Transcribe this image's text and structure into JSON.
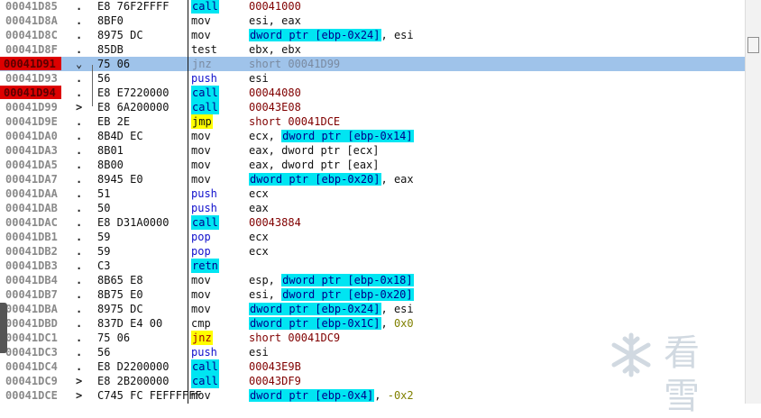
{
  "listing": {
    "rows": [
      {
        "addr": "00041D85",
        "marker": ".",
        "hex": "E8 76F2FFFF",
        "mnemonic": "call",
        "mclass": "call",
        "operand": [
          {
            "t": "00041000",
            "c": "target"
          }
        ]
      },
      {
        "addr": "00041D8A",
        "marker": ".",
        "hex": "8BF0",
        "mnemonic": "mov",
        "mclass": "mov",
        "operand": [
          {
            "t": "esi, eax",
            "c": "plain"
          }
        ]
      },
      {
        "addr": "00041D8C",
        "marker": ".",
        "hex": "8975 DC",
        "mnemonic": "mov",
        "mclass": "mov",
        "operand": [
          {
            "t": "dword ptr [ebp-0x24]",
            "c": "mem"
          },
          {
            "t": ", esi",
            "c": "plain"
          }
        ]
      },
      {
        "addr": "00041D8F",
        "marker": ".",
        "hex": "85DB",
        "mnemonic": "test",
        "mclass": "test",
        "operand": [
          {
            "t": "ebx, ebx",
            "c": "plain"
          }
        ]
      },
      {
        "addr": "00041D91",
        "marker": "⌄",
        "hex": "75 06",
        "mnemonic": "jnz",
        "mclass": "jcc",
        "operand": [
          {
            "t": "short 00041D99",
            "c": "plain"
          }
        ],
        "breakpoint": true,
        "selected": true
      },
      {
        "addr": "00041D93",
        "marker": ".",
        "hex": "56",
        "mnemonic": "push",
        "mclass": "push",
        "operand": [
          {
            "t": "esi",
            "c": "plain"
          }
        ]
      },
      {
        "addr": "00041D94",
        "marker": ".",
        "hex": "E8 E7220000",
        "mnemonic": "call",
        "mclass": "call",
        "operand": [
          {
            "t": "00044080",
            "c": "target"
          }
        ],
        "breakpoint": true
      },
      {
        "addr": "00041D99",
        "marker": ">",
        "hex": "E8 6A200000",
        "mnemonic": "call",
        "mclass": "call",
        "operand": [
          {
            "t": "00043E08",
            "c": "target"
          }
        ]
      },
      {
        "addr": "00041D9E",
        "marker": ".",
        "hex": "EB 2E",
        "mnemonic": "jmp",
        "mclass": "jmp",
        "operand": [
          {
            "t": "short 00041DCE",
            "c": "target"
          }
        ]
      },
      {
        "addr": "00041DA0",
        "marker": ".",
        "hex": "8B4D EC",
        "mnemonic": "mov",
        "mclass": "mov",
        "operand": [
          {
            "t": "ecx, ",
            "c": "plain"
          },
          {
            "t": "dword ptr [ebp-0x14]",
            "c": "mem"
          }
        ]
      },
      {
        "addr": "00041DA3",
        "marker": ".",
        "hex": "8B01",
        "mnemonic": "mov",
        "mclass": "mov",
        "operand": [
          {
            "t": "eax, dword ptr [ecx]",
            "c": "plain"
          }
        ]
      },
      {
        "addr": "00041DA5",
        "marker": ".",
        "hex": "8B00",
        "mnemonic": "mov",
        "mclass": "mov",
        "operand": [
          {
            "t": "eax, dword ptr [eax]",
            "c": "plain"
          }
        ]
      },
      {
        "addr": "00041DA7",
        "marker": ".",
        "hex": "8945 E0",
        "mnemonic": "mov",
        "mclass": "mov",
        "operand": [
          {
            "t": "dword ptr [ebp-0x20]",
            "c": "mem"
          },
          {
            "t": ", eax",
            "c": "plain"
          }
        ]
      },
      {
        "addr": "00041DAA",
        "marker": ".",
        "hex": "51",
        "mnemonic": "push",
        "mclass": "push",
        "operand": [
          {
            "t": "ecx",
            "c": "plain"
          }
        ]
      },
      {
        "addr": "00041DAB",
        "marker": ".",
        "hex": "50",
        "mnemonic": "push",
        "mclass": "push",
        "operand": [
          {
            "t": "eax",
            "c": "plain"
          }
        ]
      },
      {
        "addr": "00041DAC",
        "marker": ".",
        "hex": "E8 D31A0000",
        "mnemonic": "call",
        "mclass": "call",
        "operand": [
          {
            "t": "00043884",
            "c": "target"
          }
        ]
      },
      {
        "addr": "00041DB1",
        "marker": ".",
        "hex": "59",
        "mnemonic": "pop",
        "mclass": "pop",
        "operand": [
          {
            "t": "ecx",
            "c": "plain"
          }
        ]
      },
      {
        "addr": "00041DB2",
        "marker": ".",
        "hex": "59",
        "mnemonic": "pop",
        "mclass": "pop",
        "operand": [
          {
            "t": "ecx",
            "c": "plain"
          }
        ]
      },
      {
        "addr": "00041DB3",
        "marker": ".",
        "hex": "C3",
        "mnemonic": "retn",
        "mclass": "retn",
        "operand": []
      },
      {
        "addr": "00041DB4",
        "marker": ".",
        "hex": "8B65 E8",
        "mnemonic": "mov",
        "mclass": "mov",
        "operand": [
          {
            "t": "esp, ",
            "c": "plain"
          },
          {
            "t": "dword ptr [ebp-0x18]",
            "c": "mem"
          }
        ]
      },
      {
        "addr": "00041DB7",
        "marker": ".",
        "hex": "8B75 E0",
        "mnemonic": "mov",
        "mclass": "mov",
        "operand": [
          {
            "t": "esi, ",
            "c": "plain"
          },
          {
            "t": "dword ptr [ebp-0x20]",
            "c": "mem"
          }
        ]
      },
      {
        "addr": "00041DBA",
        "marker": ".",
        "hex": "8975 DC",
        "mnemonic": "mov",
        "mclass": "mov",
        "operand": [
          {
            "t": "dword ptr [ebp-0x24]",
            "c": "mem"
          },
          {
            "t": ", esi",
            "c": "plain"
          }
        ]
      },
      {
        "addr": "00041DBD",
        "marker": ".",
        "hex": "837D E4 00",
        "mnemonic": "cmp",
        "mclass": "cmp",
        "operand": [
          {
            "t": "dword ptr [ebp-0x1C]",
            "c": "mem"
          },
          {
            "t": ", ",
            "c": "plain"
          },
          {
            "t": "0x0",
            "c": "imm"
          }
        ]
      },
      {
        "addr": "00041DC1",
        "marker": ".",
        "hex": "75 06",
        "mnemonic": "jnz",
        "mclass": "jcc",
        "operand": [
          {
            "t": "short 00041DC9",
            "c": "target"
          }
        ]
      },
      {
        "addr": "00041DC3",
        "marker": ".",
        "hex": "56",
        "mnemonic": "push",
        "mclass": "push",
        "operand": [
          {
            "t": "esi",
            "c": "plain"
          }
        ]
      },
      {
        "addr": "00041DC4",
        "marker": ".",
        "hex": "E8 D2200000",
        "mnemonic": "call",
        "mclass": "call",
        "operand": [
          {
            "t": "00043E9B",
            "c": "target"
          }
        ]
      },
      {
        "addr": "00041DC9",
        "marker": ">",
        "hex": "E8 2B200000",
        "mnemonic": "call",
        "mclass": "call",
        "operand": [
          {
            "t": "00043DF9",
            "c": "target"
          }
        ]
      },
      {
        "addr": "00041DCE",
        "marker": ">",
        "hex": "C745 FC FEFFFFFF",
        "mnemonic": "mov",
        "mclass": "mov",
        "operand": [
          {
            "t": "dword ptr [ebp-0x4]",
            "c": "mem"
          },
          {
            "t": ", ",
            "c": "plain"
          },
          {
            "t": "-0x2",
            "c": "imm"
          }
        ]
      }
    ]
  },
  "watermark": {
    "text": "看雪",
    "icon": "snowflake-icon"
  },
  "colors": {
    "breakpoint": "#dd0000",
    "selection": "#9fc3ea",
    "call_highlight": "#00e5f2",
    "jump_highlight": "#ffff00"
  }
}
